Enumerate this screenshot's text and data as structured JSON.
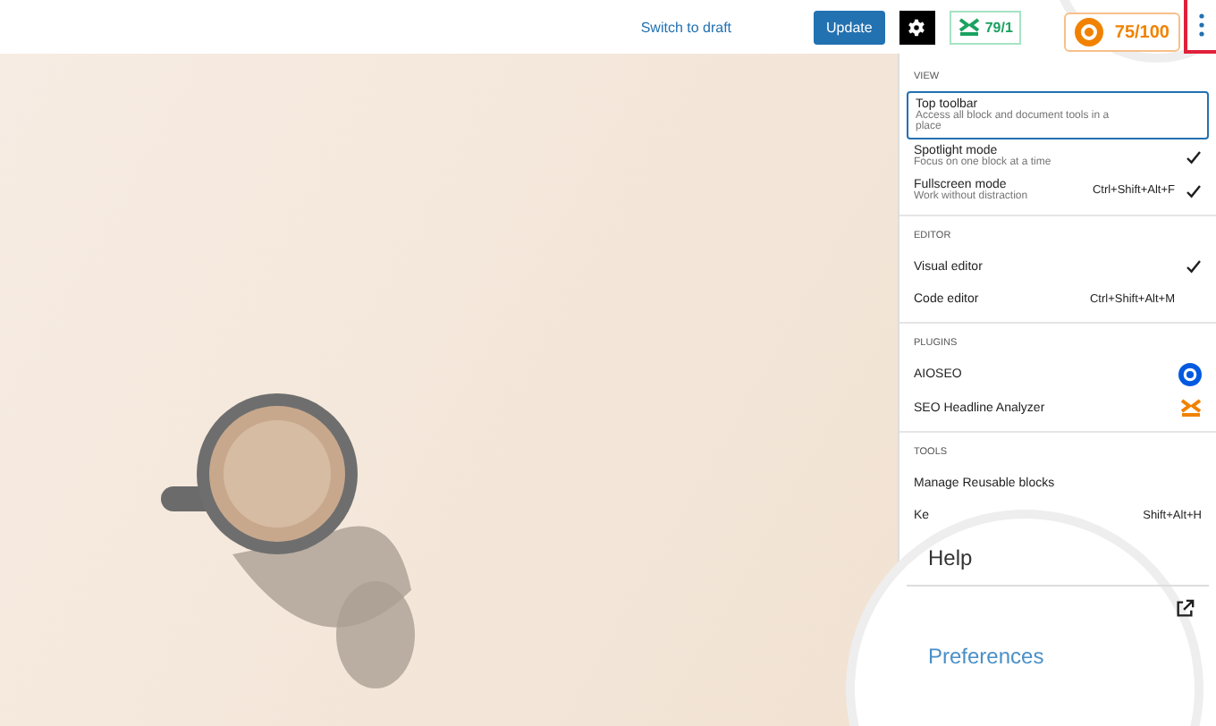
{
  "header": {
    "link": "Switch to draft",
    "update": "Update",
    "headline_score": "79/1",
    "aioseo_score": "75/100"
  },
  "menu": [
    {
      "title": "VIEW",
      "items": [
        {
          "kind": "toggle",
          "label": "Top toolbar",
          "description": [
            "Access all block and document tools in a",
            "place"
          ],
          "checked": false,
          "selected": true
        },
        {
          "kind": "toggle",
          "label": "Spotlight mode",
          "description": [
            "Focus on one block at a time"
          ],
          "checked": true,
          "selected": false
        },
        {
          "kind": "toggle",
          "label": "Fullscreen mode",
          "description": [
            "Work without distraction"
          ],
          "shortcut": "Ctrl+Shift+Alt+F",
          "checked": true,
          "selected": false
        }
      ]
    },
    {
      "title": "EDITOR",
      "items": [
        {
          "kind": "toggle",
          "label": "Visual editor",
          "checked": true,
          "selected": false
        },
        {
          "kind": "toggle",
          "label": "Code editor",
          "shortcut": "Ctrl+Shift+Alt+M",
          "checked": false,
          "selected": false
        }
      ]
    },
    {
      "title": "PLUGINS",
      "items": [
        {
          "kind": "plugin-gear",
          "label": "AIOSEO"
        },
        {
          "kind": "plugin-bars",
          "label": "SEO Headline Analyzer"
        }
      ]
    },
    {
      "title": "TOOLS",
      "items": [
        {
          "kind": "plain",
          "label": "Manage Reusable blocks"
        },
        {
          "kind": "plain",
          "label": "Ke",
          "shortcut": "Shift+Alt+H"
        },
        {
          "kind": "magnified",
          "label": "Help"
        },
        {
          "kind": "external"
        },
        {
          "kind": "magnified-link",
          "label": "Preferences"
        }
      ]
    }
  ]
}
